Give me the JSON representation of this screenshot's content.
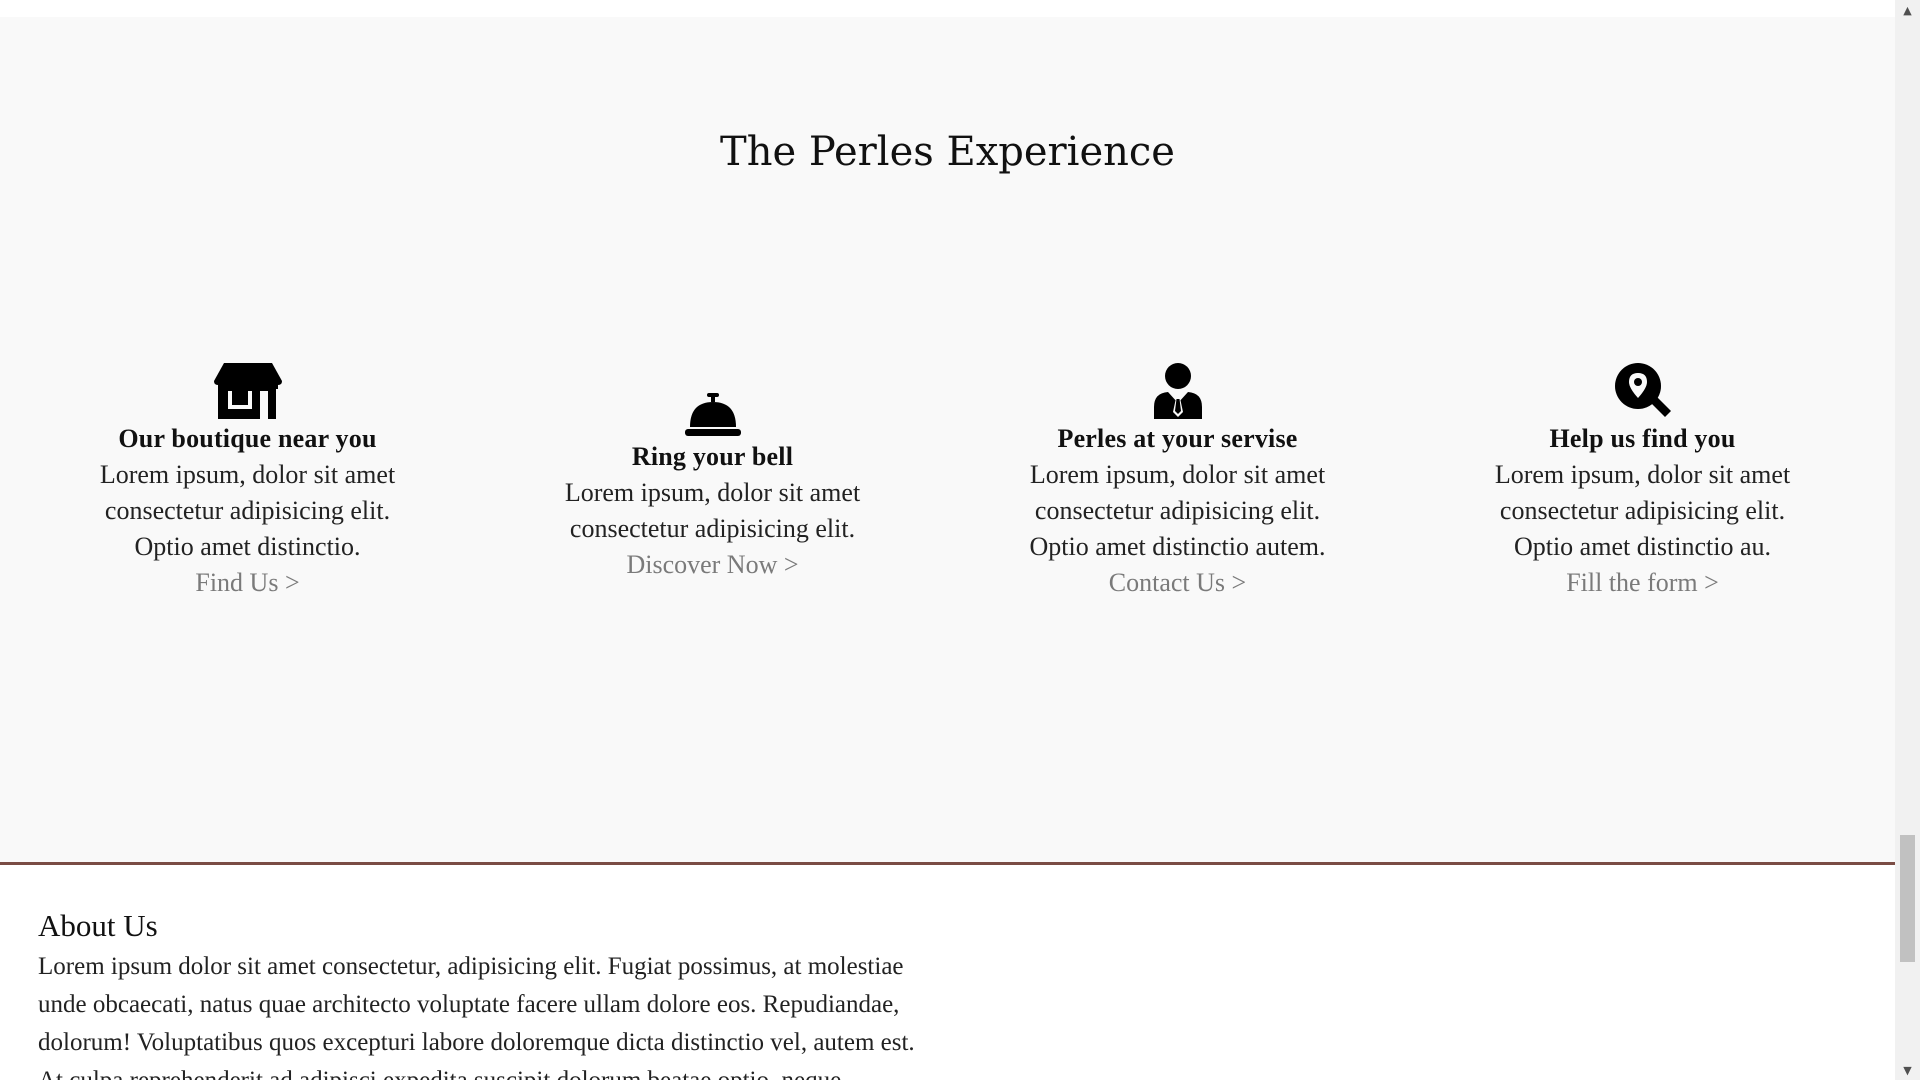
{
  "experience": {
    "title": "The Perles Experience",
    "cards": [
      {
        "title": "Our boutique near you",
        "lines": [
          "Lorem ipsum, dolor sit amet",
          "consectetur adipisicing elit.",
          "Optio amet distinctio."
        ],
        "link": "Find Us >",
        "icon": "store-icon"
      },
      {
        "title": "Ring your bell",
        "lines": [
          "Lorem ipsum, dolor sit amet",
          "consectetur adipisicing elit."
        ],
        "link": "Discover Now >",
        "icon": "concierge-bell-icon"
      },
      {
        "title": "Perles at your servise",
        "lines": [
          "Lorem ipsum, dolor sit amet",
          "consectetur adipisicing elit.",
          "Optio amet distinctio autem."
        ],
        "link": "Contact Us >",
        "icon": "user-tie-icon"
      },
      {
        "title": "Help us find you",
        "lines": [
          "Lorem ipsum, dolor sit amet",
          "consectetur adipisicing elit.",
          "Optio amet distinctio au."
        ],
        "link": "Fill the form >",
        "icon": "search-location-icon"
      }
    ]
  },
  "about": {
    "title": "About Us",
    "lines": [
      "Lorem ipsum dolor sit amet consectetur, adipisicing elit. Fugiat possimus, at molestiae",
      "unde obcaecati, natus quae architecto voluptate facere ullam dolore eos. Repudiandae,",
      "dolorum! Voluptatibus quos excepturi labore doloremque dicta distinctio vel, autem est.",
      "At culpa reprehenderit ad adipisci expedita suscipit dolorum beatae optio, neque"
    ]
  },
  "colors": {
    "section_background": "#f9f9f9",
    "divider": "#7a4c44",
    "link": "#7a7a7a"
  }
}
